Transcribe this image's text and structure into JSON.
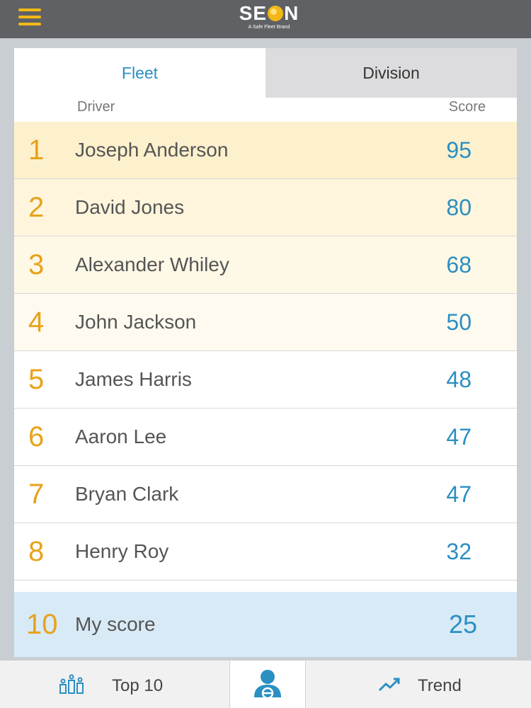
{
  "header": {
    "brand": "SEON",
    "brand_prefix": "SE",
    "brand_suffix": "N",
    "tagline": "A Safe Fleet Brand",
    "menu_icon": "hamburger-menu-icon",
    "accent_color": "#f2b816"
  },
  "tabs": [
    {
      "label": "Fleet",
      "active": true
    },
    {
      "label": "Division",
      "active": false
    }
  ],
  "columns": {
    "driver": "Driver",
    "score": "Score"
  },
  "rows": [
    {
      "rank": "1",
      "name": "Joseph Anderson",
      "score": "95",
      "bg": "#fdf0cc"
    },
    {
      "rank": "2",
      "name": "David Jones",
      "score": "80",
      "bg": "#fef5dc"
    },
    {
      "rank": "3",
      "name": "Alexander Whiley",
      "score": "68",
      "bg": "#fef8e6"
    },
    {
      "rank": "4",
      "name": "John Jackson",
      "score": "50",
      "bg": "#fefaef"
    },
    {
      "rank": "5",
      "name": "James Harris",
      "score": "48",
      "bg": "#ffffff"
    },
    {
      "rank": "6",
      "name": "Aaron Lee",
      "score": "47",
      "bg": "#ffffff"
    },
    {
      "rank": "7",
      "name": "Bryan Clark",
      "score": "47",
      "bg": "#ffffff"
    },
    {
      "rank": "8",
      "name": "Henry Roy",
      "score": "32",
      "bg": "#ffffff"
    }
  ],
  "my_score": {
    "rank": "10",
    "name": "My score",
    "score": "25"
  },
  "bottom_nav": {
    "top10_label": "Top 10",
    "top10_icon": "leaderboard-icon",
    "driver_icon": "driver-icon",
    "trend_label": "Trend",
    "trend_icon": "trend-icon"
  },
  "colors": {
    "rank": "#e8a21a",
    "score": "#2b8fc2",
    "active_tab": "#2b8fc2",
    "my_score_bg": "#d8eaf6"
  }
}
